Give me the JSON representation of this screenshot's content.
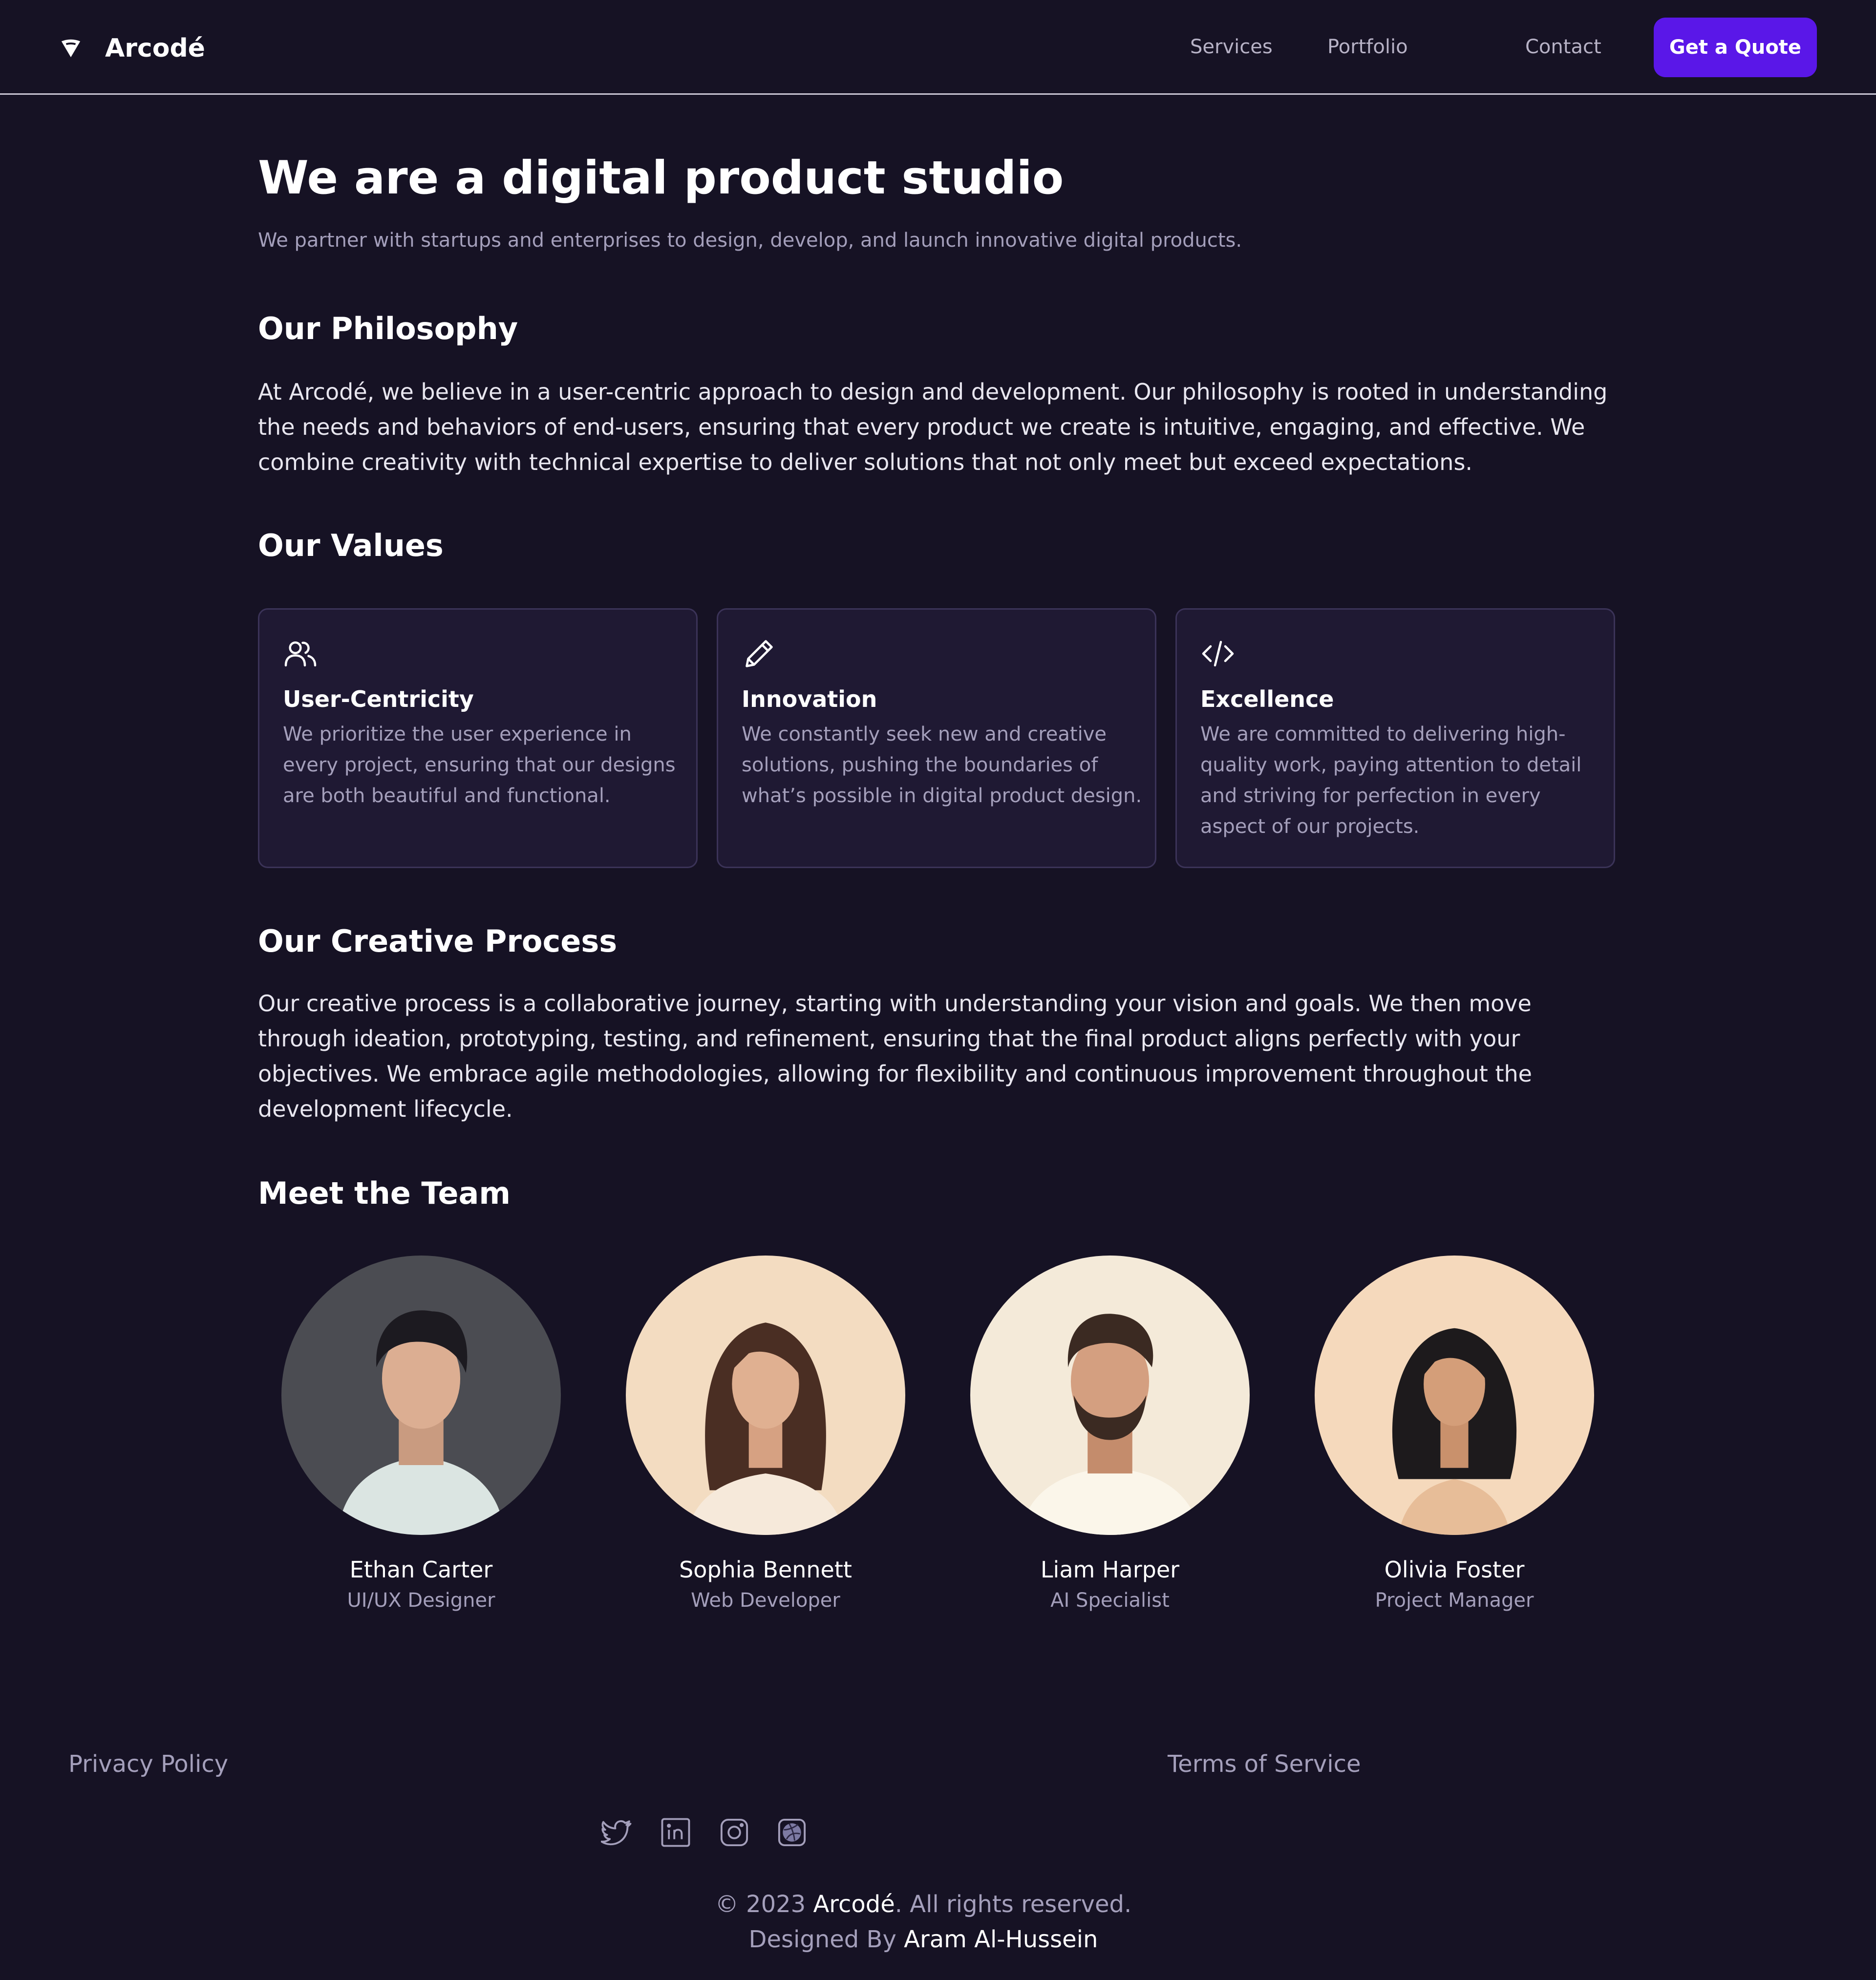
{
  "nav": {
    "brand": "Arcodé",
    "links": [
      "Services",
      "Portfolio",
      "Contact"
    ],
    "cta": "Get a Quote"
  },
  "hero": {
    "title": "We are a digital product studio",
    "subtitle": "We partner with startups and enterprises to design, develop, and launch innovative digital products."
  },
  "philosophy": {
    "heading": "Our Philosophy",
    "body": "At Arcodé, we believe in a user-centric approach to design and development. Our philosophy is rooted in understanding the needs and behaviors of end-users, ensuring that every product we create is intuitive, engaging, and effective. We combine creativity with technical expertise to deliver solutions that not only meet but exceed expectations."
  },
  "values": {
    "heading": "Our Values",
    "items": [
      {
        "icon": "users-icon",
        "title": "User-Centricity",
        "desc": "We prioritize the user experience in every project, ensuring that our designs are both beautiful and functional."
      },
      {
        "icon": "pencil-icon",
        "title": "Innovation",
        "desc": "We constantly seek new and creative solutions, pushing the boundaries of what’s possible in digital product design."
      },
      {
        "icon": "code-icon",
        "title": "Excellence",
        "desc": "We are committed to delivering high-quality work, paying attention to detail and striving for perfection in every aspect of our projects."
      }
    ]
  },
  "process": {
    "heading": "Our Creative Process",
    "body": "Our creative process is a collaborative journey, starting with understanding your vision and goals. We then move through ideation, prototyping, testing, and refinement, ensuring that the final product aligns perfectly with your objectives. We embrace agile methodologies, allowing for flexibility and continuous improvement throughout the development lifecycle."
  },
  "team": {
    "heading": "Meet the Team",
    "members": [
      {
        "name": "Ethan Carter",
        "role": "UI/UX Designer"
      },
      {
        "name": "Sophia Bennett",
        "role": "Web Developer"
      },
      {
        "name": "Liam Harper",
        "role": "AI Specialist"
      },
      {
        "name": "Olivia Foster",
        "role": "Project Manager"
      }
    ]
  },
  "footer": {
    "privacy": "Privacy Policy",
    "terms": "Terms of Service",
    "social": [
      "twitter-icon",
      "linkedin-icon",
      "instagram-icon",
      "dribbble-icon"
    ],
    "copyright_prefix": "© 2023 ",
    "copyright_brand": "Arcodé",
    "copyright_suffix": ". All rights reserved.",
    "designed_prefix": "Designed By ",
    "designer": "Aram Al-Hussein"
  },
  "colors": {
    "background": "#161224",
    "accent": "#5a17e8",
    "muted_text": "#a49fbb",
    "card_bg": "#1f1933"
  }
}
